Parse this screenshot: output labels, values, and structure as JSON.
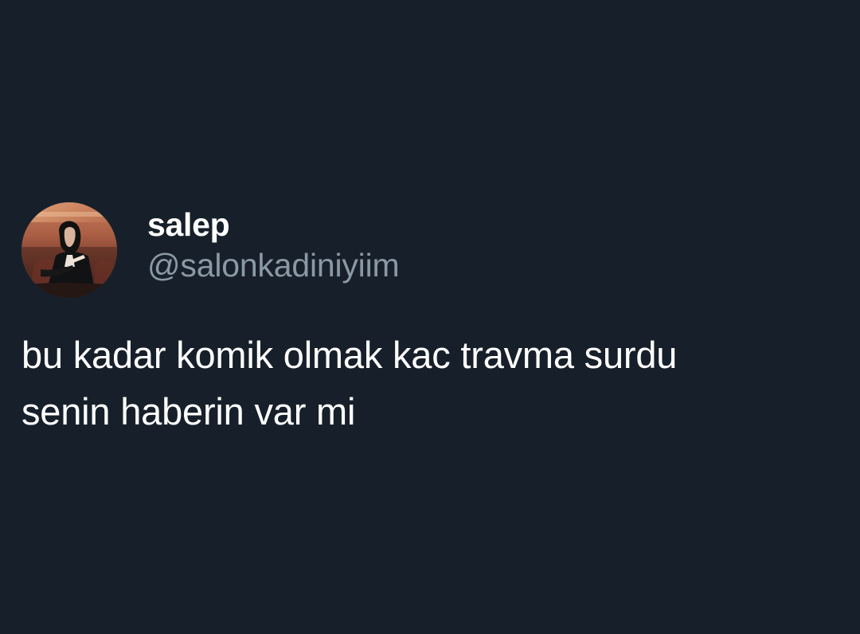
{
  "tweet": {
    "author": {
      "display_name": "salep",
      "handle": "@salonkadiniyiim",
      "avatar_icon": "profile-photo"
    },
    "text": "bu kadar komik olmak kac travma surdu\nsenin haberin var mi"
  },
  "colors": {
    "background": "#17202a",
    "primary_text": "#ffffff",
    "secondary_text": "#8b98a5"
  }
}
